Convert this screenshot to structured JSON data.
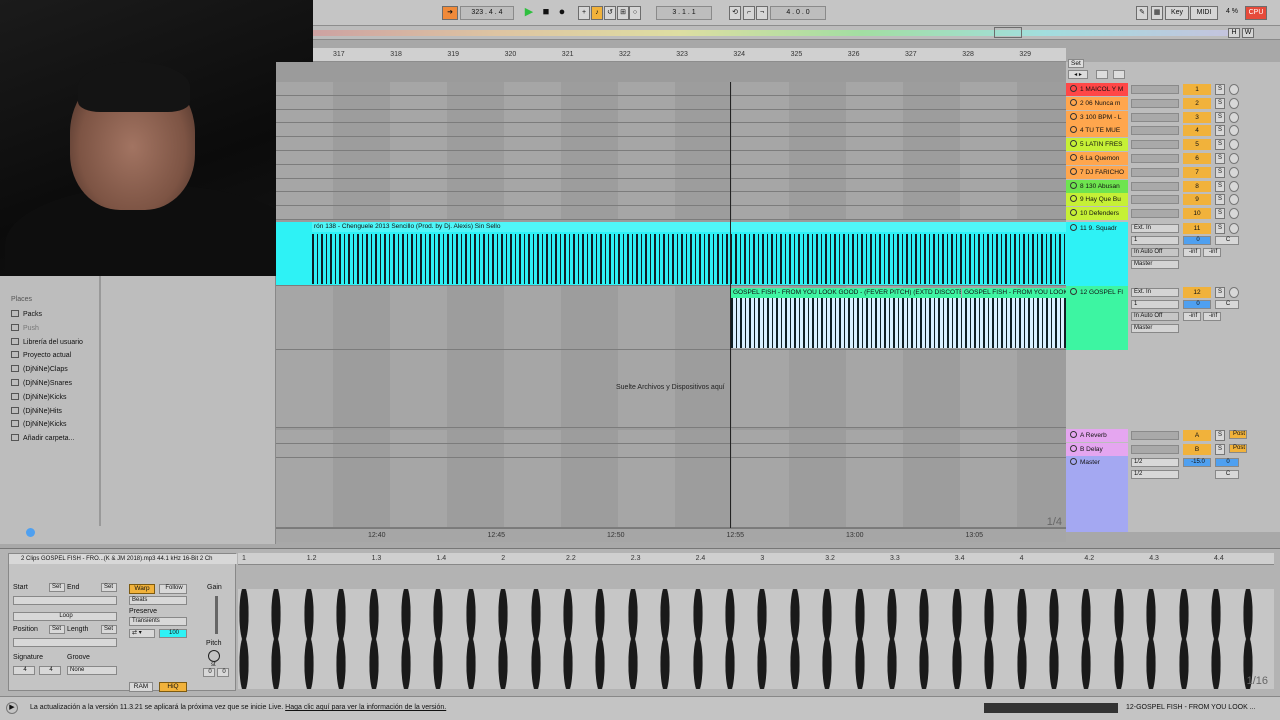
{
  "transport": {
    "position": "323 . 4 . 4",
    "loop_start": "3 . 1 . 1",
    "loop_length": "4 . 0 . 0",
    "key_label": "Key",
    "midi_label": "MIDI",
    "cpu_percent": "4 %",
    "cpu_label": "CPU",
    "h_label": "H",
    "w_label": "W"
  },
  "ruler": {
    "bars": [
      "317",
      "318",
      "319",
      "320",
      "321",
      "322",
      "323",
      "324",
      "325",
      "326",
      "327",
      "328",
      "329"
    ],
    "set_label": "Set"
  },
  "clips": {
    "track11_clip": "rón 138 - Chenguele 2013 Sencillo (Prod. by Dj. Alexis) Sin Sello",
    "track12_clip_a": "GOSPEL FISH - FROM YOU LOOK GOOD - (FEVER PITCH) (EXTD DISCOTE",
    "track12_clip_b": "GOSPEL FISH - FROM YOU LOOK"
  },
  "drop_hint": "Suelte Archivos y Dispositivos aquí",
  "time_labels": [
    "12:40",
    "12:45",
    "12:50",
    "12:55",
    "13:00",
    "13:05"
  ],
  "arrange_zoom": "1/4",
  "tracks": [
    {
      "name": "1 MAICOL Y M",
      "num": "1",
      "color": "#ff4747"
    },
    {
      "name": "2 06 Nunca m",
      "num": "2",
      "color": "#ffa64d"
    },
    {
      "name": "3 100 BPM - L",
      "num": "3",
      "color": "#ffa64d"
    },
    {
      "name": "4 TU TE MUE",
      "num": "4",
      "color": "#ffa64d"
    },
    {
      "name": "5 LATIN FRES",
      "num": "5",
      "color": "#c6f036"
    },
    {
      "name": "6 La Quemon",
      "num": "6",
      "color": "#ffa64d"
    },
    {
      "name": "7 DJ FARICHO",
      "num": "7",
      "color": "#ffa64d"
    },
    {
      "name": "8 130 Abusan",
      "num": "8",
      "color": "#6ee44f"
    },
    {
      "name": "9 Hay Que Bu",
      "num": "9",
      "color": "#c6f036"
    },
    {
      "name": "10 Defenders",
      "num": "10",
      "color": "#c6f036"
    }
  ],
  "big_tracks": [
    {
      "name": "11 9. Squadr",
      "num": "11",
      "color": "#2ef2f5",
      "input": "Ext. In",
      "channel": "1",
      "vol": "0",
      "pan": "C",
      "monitor": [
        "In",
        "Auto",
        "Off"
      ],
      "out": "Master",
      "inf1": "-inf",
      "inf2": "-inf"
    },
    {
      "name": "12 GOSPEL FI",
      "num": "12",
      "color": "#3df5a2",
      "input": "Ext. In",
      "channel": "1",
      "vol": "0",
      "pan": "C",
      "monitor": [
        "In",
        "Auto",
        "Off"
      ],
      "out": "Master",
      "inf1": "-inf",
      "inf2": "-inf"
    }
  ],
  "returns": [
    {
      "name": "A Reverb",
      "num": "A",
      "color": "#e5a6f0",
      "post": "Post"
    },
    {
      "name": "B Delay",
      "num": "B",
      "color": "#e5a6f0",
      "post": "Post"
    }
  ],
  "master": {
    "name": "Master",
    "color": "#a4a8f2",
    "cue1": "1/2",
    "cue2": "1/2",
    "vol": "-15.0",
    "vol2": "0",
    "pan": "C"
  },
  "browser": {
    "places_header": "Places",
    "items": [
      {
        "label": "Packs",
        "dim": false
      },
      {
        "label": "Push",
        "dim": true
      },
      {
        "label": "Librería del usuario",
        "dim": false
      },
      {
        "label": "Proyecto actual",
        "dim": false
      },
      {
        "label": "(DjNiNe)Claps",
        "dim": false
      },
      {
        "label": "(DjNiNe)Snares",
        "dim": false
      },
      {
        "label": "(DjNiNe)Kicks",
        "dim": false
      },
      {
        "label": "(DjNiNe)Hits",
        "dim": false
      },
      {
        "label": "(DjNiNe)Kicks",
        "dim": false
      },
      {
        "label": "Añadir carpeta...",
        "dim": false
      }
    ]
  },
  "detail": {
    "title": "2 Clips  GOSPEL FISH - FRO...(K & JM 2018).mp3     44.1 kHz  16-Bit  2 Ch",
    "start_label": "Start",
    "end_label": "End",
    "set_label": "Set",
    "loop_label": "Loop",
    "position_label": "Position",
    "length_label": "Length",
    "signature_label": "Signature",
    "groove_label": "Groove",
    "sig_num": "4",
    "sig_den": "4",
    "groove_value": "None",
    "warp_label": "Warp",
    "follow_label": "Follow",
    "warp_mode": "Beats",
    "preserve_label": "Preserve",
    "preserve_value": "Transients",
    "env_value": "100",
    "gain_label": "Gain",
    "pitch_label": "Pitch",
    "pitch_st": "st",
    "pitch_a": "0",
    "pitch_b": "0",
    "ram_label": "RAM",
    "hiq_label": "HiQ",
    "ruler": [
      "1",
      "1.2",
      "1.3",
      "1.4",
      "2",
      "2.2",
      "2.3",
      "2.4",
      "3",
      "3.2",
      "3.3",
      "3.4",
      "4",
      "4.2",
      "4.3",
      "4.4"
    ],
    "zoom": "1/16"
  },
  "status": {
    "message": "La actualización a la versión 11.3.21 se aplicará la próxima vez que se inicie Live.",
    "link": "Haga clic aquí para ver la información de la versión.",
    "right": "12-GOSPEL FISH - FROM YOU LOOK ..."
  }
}
